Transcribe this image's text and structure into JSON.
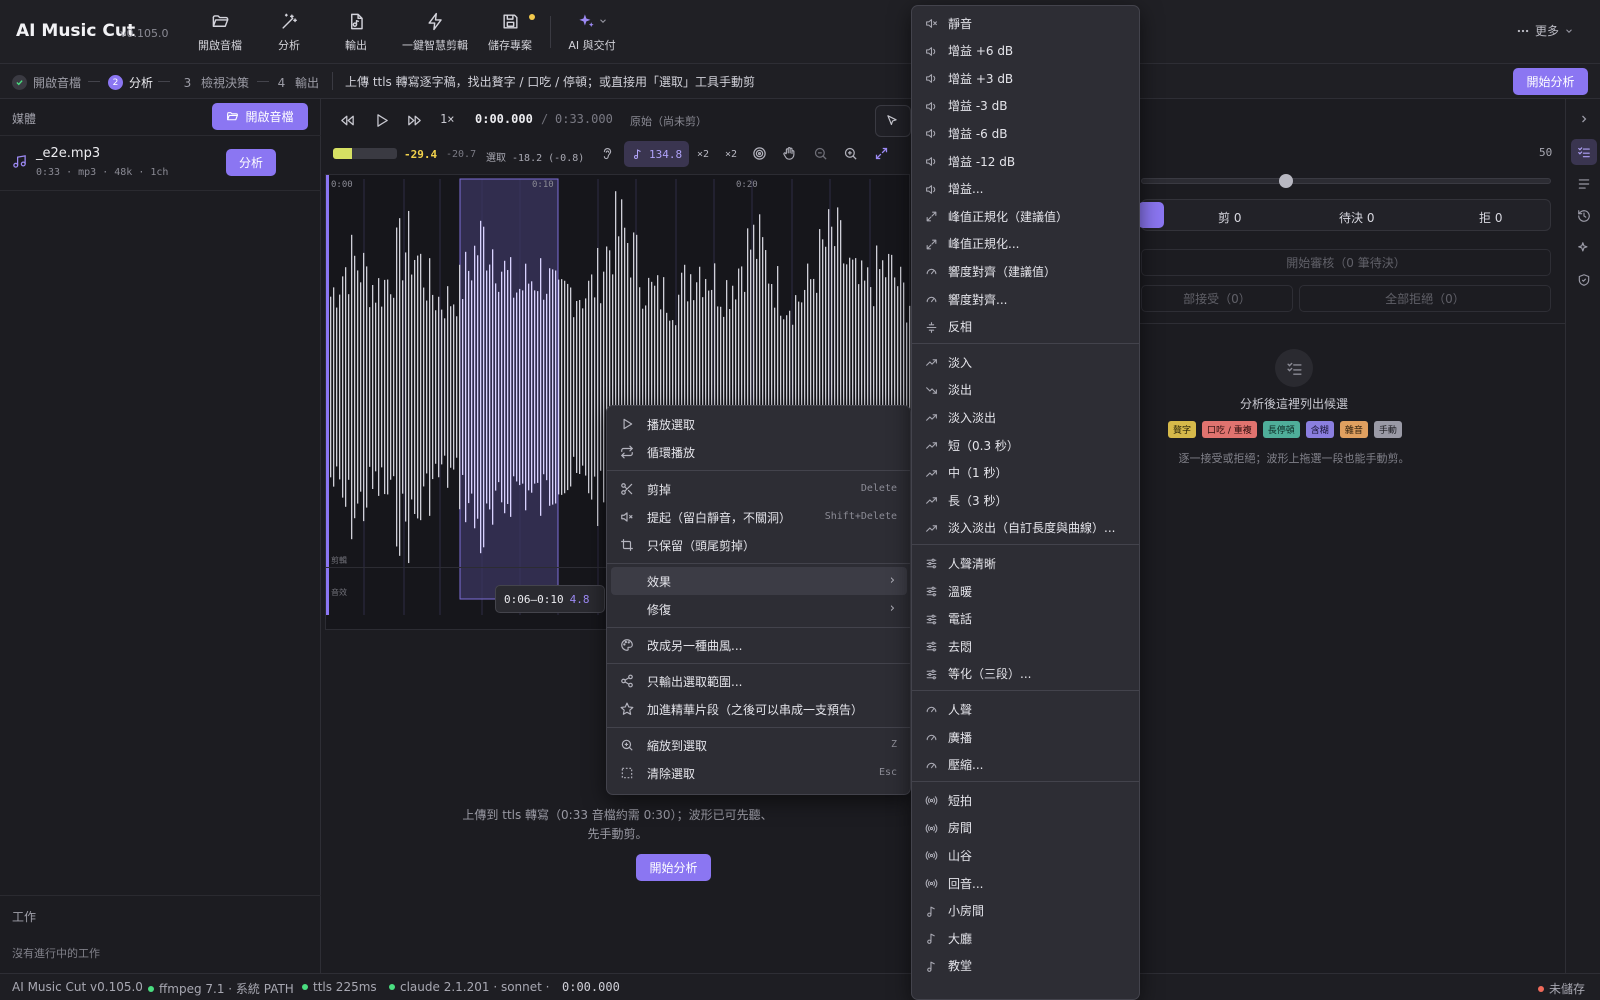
{
  "app": {
    "title": "AI Music Cut",
    "version": "v0.105.0"
  },
  "toolbar": {
    "open_audio": "開啟音檔",
    "analyze": "分析",
    "export": "輸出",
    "smart_cut": "一鍵智慧剪輯",
    "save_project": "儲存專案",
    "ai_deliver": "AI 與交付",
    "more": "更多"
  },
  "steps": {
    "step1": "開啟音檔",
    "step2_num": "2",
    "step2": "分析",
    "step3_num": "3",
    "step3": "檢視決策",
    "step4_num": "4",
    "step4": "輸出",
    "hint": "上傳 ttls 轉寫逐字稿，找出贅字 / 口吃 / 停頓；或直接用「選取」工具手動剪",
    "start_analysis": "開始分析"
  },
  "sidebar": {
    "media_title": "媒體",
    "open_audio_button": "開啟音檔",
    "media": {
      "name": "_e2e.mp3",
      "meta": "0:33 · mp3 · 48k · 1ch",
      "analyze_button": "分析"
    },
    "jobs_title": "工作",
    "jobs_empty": "沒有進行中的工作"
  },
  "transport": {
    "speed": "1×",
    "current_time": "0:00.000",
    "separator": "/",
    "total_time": "0:33.000",
    "mode": "原始（尚未剪）",
    "level": "-29.4",
    "level_peak": "-20.7",
    "selection_level": "選取 -18.2 (-0.8)",
    "bpm": "134.8",
    "mult_a": "×2",
    "mult_b": "×2",
    "level_fraction": 0.3
  },
  "waveform": {
    "time_0": "0:00",
    "time_10": "0:10",
    "time_20": "0:20",
    "lane_a": "剪輯",
    "lane_b": "音效",
    "selection_start": "0:06",
    "selection_end": "0:10",
    "selection_label": "0:06–0:10",
    "selection_extra": "4.8"
  },
  "empty_state": {
    "line1": "上傳到 ttls 轉寫（0:33 音檔約需 0:30）；波形已可先聽、",
    "line2": "先手動剪。",
    "button": "開始分析"
  },
  "right_panel": {
    "threshold_value": "50",
    "threshold_fraction": 0.35,
    "counts": {
      "cut": "剪 0",
      "pending": "待決 0",
      "rejected": "拒 0"
    },
    "start_review": "開始審核（0 筆待決）",
    "accept_all": "部接受（0）",
    "reject_all": "全部拒絕（0）",
    "empty_title": "分析後這裡列出候選",
    "empty_hint": "逐一接受或拒絕；波形上拖選一段也能手動剪。",
    "tags": [
      {
        "label": "贅字",
        "bg": "#d6b94a",
        "fg": "#2a2408"
      },
      {
        "label": "口吃 / 重複",
        "bg": "#e0736f",
        "fg": "#2b0e0e"
      },
      {
        "label": "長停頓",
        "bg": "#4fae9a",
        "fg": "#0d2a24"
      },
      {
        "label": "含糊",
        "bg": "#8b7fe0",
        "fg": "#1a1538"
      },
      {
        "label": "雜音",
        "bg": "#e0a060",
        "fg": "#2b1c0b"
      },
      {
        "label": "手動",
        "bg": "#9a9aa6",
        "fg": "#1c1c21"
      }
    ]
  },
  "context_menu": {
    "play_selection": "播放選取",
    "loop_play": "循環播放",
    "cut": "剪掉",
    "cut_shortcut": "Delete",
    "lift": "提起（留白靜音，不關洞）",
    "lift_shortcut": "Shift+Delete",
    "keep_only": "只保留（頭尾剪掉）",
    "effects": "效果",
    "repair": "修復",
    "restyle": "改成另一種曲風...",
    "export_selection": "只輸出選取範圍...",
    "add_highlight": "加進精華片段（之後可以串成一支預告）",
    "zoom_to_selection": "縮放到選取",
    "zoom_shortcut": "Z",
    "clear_selection": "清除選取",
    "clear_shortcut": "Esc"
  },
  "effects_menu": [
    "靜音",
    "增益 +6 dB",
    "增益 +3 dB",
    "增益 -3 dB",
    "增益 -6 dB",
    "增益 -12 dB",
    "增益...",
    "峰值正規化（建議值）",
    "峰值正規化...",
    "響度對齊（建議值）",
    "響度對齊...",
    "反相",
    "淡入",
    "淡出",
    "淡入淡出",
    "短（0.3 秒）",
    "中（1 秒）",
    "長（3 秒）",
    "淡入淡出（自訂長度與曲線）...",
    "人聲清晰",
    "溫暖",
    "電話",
    "去悶",
    "等化（三段）...",
    "人聲",
    "廣播",
    "壓縮...",
    "短拍",
    "房間",
    "山谷",
    "回音...",
    "小房間",
    "大廳",
    "教堂"
  ],
  "status": {
    "app": "AI Music Cut v0.105.0",
    "ffmpeg": "ffmpeg 7.1 · 系統 PATH",
    "ttls": "ttls 225ms",
    "claude": "claude 2.1.201 · sonnet ·",
    "time": "0:00.000",
    "unsaved": "未儲存"
  },
  "colors": {
    "accent": "#8b76f2",
    "ok": "#4ade80",
    "warn": "#f2c94c",
    "unsaved": "#f06a5a"
  }
}
